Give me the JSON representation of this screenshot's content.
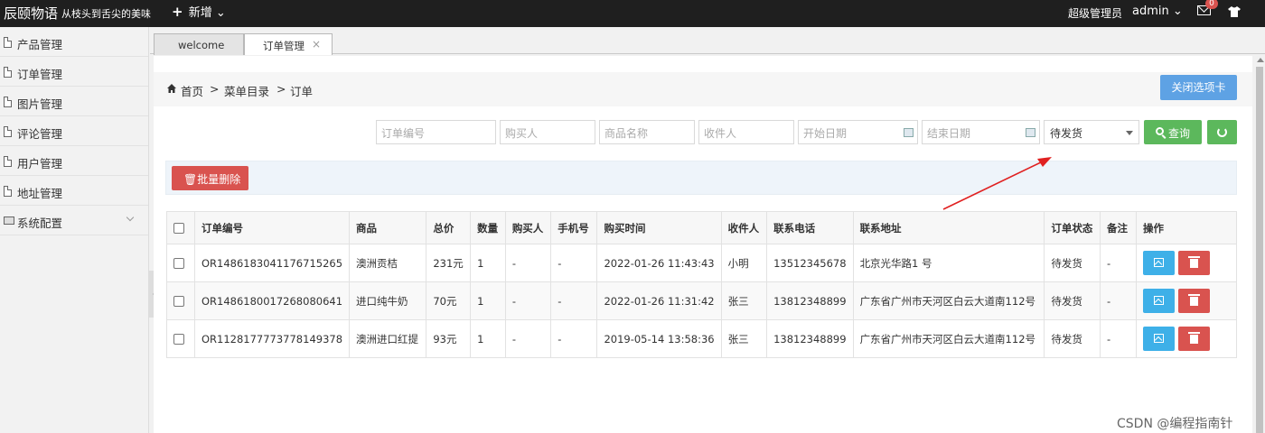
{
  "topbar": {
    "brand": "辰颐物语",
    "slogan": "从枝头到舌尖的美味",
    "new_label": "新增",
    "role": "超级管理员",
    "user": "admin",
    "mail_badge": "0"
  },
  "sidebar": {
    "items": [
      {
        "label": "产品管理"
      },
      {
        "label": "订单管理"
      },
      {
        "label": "图片管理"
      },
      {
        "label": "评论管理"
      },
      {
        "label": "用户管理"
      },
      {
        "label": "地址管理"
      },
      {
        "label": "系统配置"
      }
    ]
  },
  "tabs": [
    {
      "label": "welcome"
    },
    {
      "label": "订单管理",
      "close": "×"
    }
  ],
  "breadcrumb": {
    "home": "首页",
    "sep": ">",
    "level2": "菜单目录",
    "level3": "订单"
  },
  "close_tab_label": "关闭选项卡",
  "filters": {
    "order_no": "订单编号",
    "buyer": "购买人",
    "product": "商品名称",
    "receiver": "收件人",
    "start_date": "开始日期",
    "end_date": "结束日期",
    "status_selected": "待发货",
    "query_label": "查询"
  },
  "batch_delete_label": "批量删除",
  "table": {
    "headers": [
      "订单编号",
      "商品",
      "总价",
      "数量",
      "购买人",
      "手机号",
      "购买时间",
      "收件人",
      "联系电话",
      "联系地址",
      "订单状态",
      "备注",
      "操作"
    ],
    "rows": [
      {
        "order_no": "OR1486183041176715265",
        "product": "澳洲贡桔",
        "total": "231元",
        "qty": "1",
        "buyer": "-",
        "phone": "-",
        "time": "2022-01-26 11:43:43",
        "receiver": "小明",
        "tel": "13512345678",
        "address": "北京光华路1 号",
        "status": "待发货",
        "note": "-"
      },
      {
        "order_no": "OR1486180017268080641",
        "product": "进口纯牛奶",
        "total": "70元",
        "qty": "1",
        "buyer": "-",
        "phone": "-",
        "time": "2022-01-26 11:31:42",
        "receiver": "张三",
        "tel": "13812348899",
        "address": "广东省广州市天河区白云大道南112号",
        "status": "待发货",
        "note": "-"
      },
      {
        "order_no": "OR1128177773778149378",
        "product": "澳洲进口红提",
        "total": "93元",
        "qty": "1",
        "buyer": "-",
        "phone": "-",
        "time": "2019-05-14 13:58:36",
        "receiver": "张三",
        "tel": "13812348899",
        "address": "广东省广州市天河区白云大道南112号",
        "status": "待发货",
        "note": "-"
      }
    ]
  },
  "watermark": "CSDN @编程指南针",
  "colors": {
    "topbar": "#1f1f1f",
    "primary": "#5ea2e4",
    "success": "#5cb85c",
    "danger": "#d9534f",
    "info": "#3eb0e8",
    "annotation_arrow": "#e02020"
  }
}
